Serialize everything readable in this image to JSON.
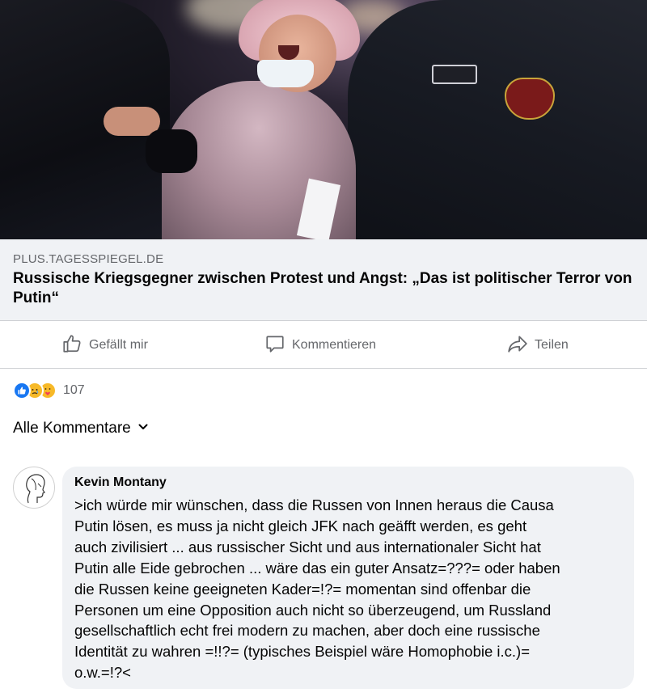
{
  "post": {
    "image_alt_icon": "news-photo",
    "link_preview": {
      "source": "PLUS.TAGESSPIEGEL.DE",
      "title": "Russische Kriegsgegner zwischen Protest und Angst: „Das ist politischer Terror von Putin“"
    },
    "actions": {
      "like_label": "Gefällt mir",
      "comment_label": "Kommentieren",
      "share_label": "Teilen"
    },
    "reactions": {
      "icons": [
        "like-icon",
        "sad-icon",
        "care-icon"
      ],
      "count": "107"
    }
  },
  "comments": {
    "filter_label": "Alle Kommentare",
    "items": [
      {
        "author": "Kevin Montany",
        "text": ">ich würde mir wünschen, dass die Russen von Innen heraus die Causa\nPutin lösen, es muss ja nicht gleich JFK nach geäfft werden, es geht\nauch zivilisiert  ... aus russischer Sicht und aus internationaler Sicht hat\nPutin alle Eide gebrochen ... wäre das ein guter Ansatz=???= oder haben\ndie Russen keine  geeigneten Kader=!?= momentan sind offenbar die\nPersonen  um eine Opposition auch nicht so überzeugend, um Russland\ngesellschaftlich echt frei modern zu machen, aber doch eine russische\nIdentität zu wahren =!!?= (typisches Beispiel wäre Homophobie i.c.)=\no.w.=!?<"
      }
    ]
  },
  "colors": {
    "secondary_text": "#65676b",
    "bubble_bg": "#f0f2f5",
    "like_blue": "#1877f2",
    "divider": "#ced0d4"
  }
}
